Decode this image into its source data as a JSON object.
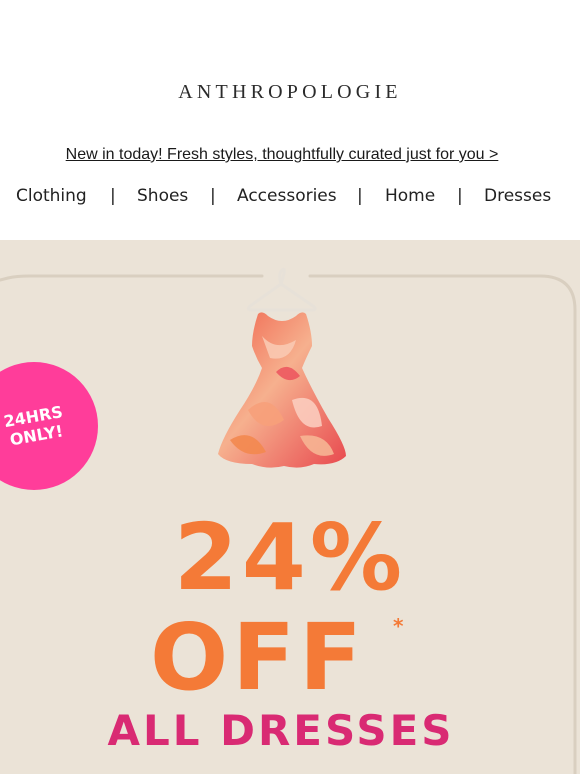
{
  "header": {
    "logo_text": "ANTHROPOLOGIE",
    "promo_link": "New in today! Fresh styles, thoughtfully curated just for you >"
  },
  "nav": {
    "items": [
      "Clothing",
      "Shoes",
      "Accessories",
      "Home",
      "Dresses"
    ],
    "separator": "|"
  },
  "hero": {
    "badge_line1": "24HRS",
    "badge_line2": "ONLY!",
    "discount": "24%",
    "off": "OFF",
    "asterisk": "*",
    "subline": "ALL DRESSES"
  },
  "colors": {
    "background": "#ebe3d7",
    "badge": "#ff3d9a",
    "orange": "#f47a37",
    "pink": "#d92a73"
  },
  "icons": {
    "product_image": "floral-dress-on-hanger"
  }
}
